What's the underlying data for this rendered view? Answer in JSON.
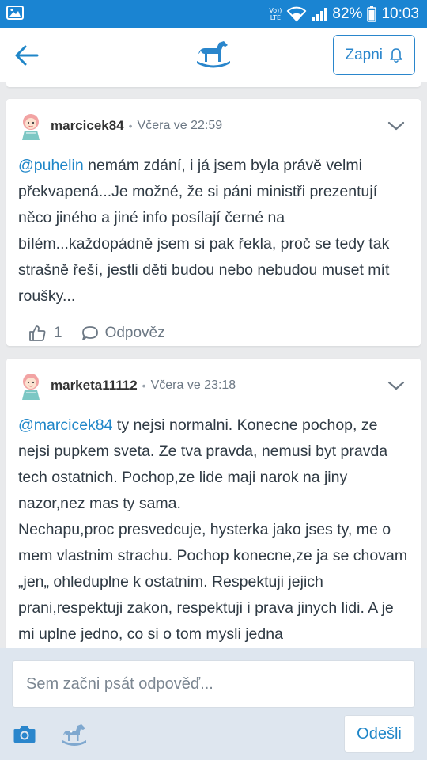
{
  "status_bar": {
    "volte_top": "Vo))",
    "volte_bottom": "LTE",
    "battery": "82%",
    "time": "10:03"
  },
  "app_bar": {
    "notify_label": "Zapni",
    "accent": "#2a86cc"
  },
  "comments": [
    {
      "username": "marcicek84",
      "time": "Včera ve 22:59",
      "mention": "@puhelin",
      "paragraphs": [
        " nemám zdání, i já jsem byla právě velmi překvapená...Je možné, že si páni ministři prezentují něco jiného a jiné info posílají černé na bílém...každopádně jsem si pak řekla, proč se tedy tak strašně řeší, jestli děti budou nebo nebudou muset mít roušky..."
      ],
      "likes": "1",
      "reply_label": "Odpověz"
    },
    {
      "username": "marketa11112",
      "time": "Včera ve 23:18",
      "mention": "@marcicek84",
      "paragraphs": [
        " ty nejsi normalni. Konecne pochop, ze nejsi pupkem sveta. Ze tva pravda, nemusi byt pravda tech ostatnich. Pochop,ze lide maji narok na jiny nazor,nez mas ty sama.",
        "Nechapu,proc presvedcuje, hysterka jako jses ty, me o mem vlastnim strachu. Pochop konecne,ze ja se chovam „jen„ ohleduplne k ostatnim. Respektuji jejich prani,respektuji zakon, respektuji i prava jinych lidi. A je mi uplne jedno, co si o tom mysli jedna"
      ]
    }
  ],
  "composer": {
    "placeholder": "Sem začni psát odpověď...",
    "send_label": "Odešli"
  }
}
